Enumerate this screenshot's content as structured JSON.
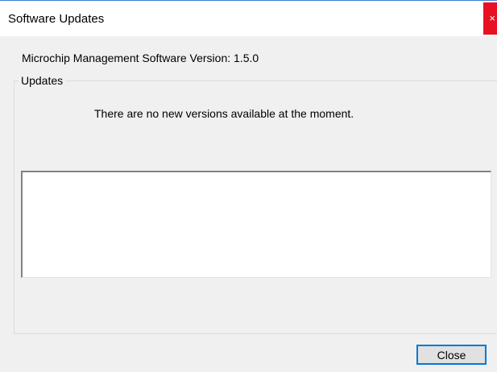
{
  "window": {
    "title": "Software Updates",
    "close_glyph": "×",
    "accent_color": "#0078d7",
    "close_color": "#e81123"
  },
  "version": {
    "label": "Microchip Management Software Version: 1.5.0"
  },
  "updates_group": {
    "legend": "Updates",
    "status_message": "There are no new versions available at the moment.",
    "notes_text": ""
  },
  "footer": {
    "close_label": "Close"
  }
}
